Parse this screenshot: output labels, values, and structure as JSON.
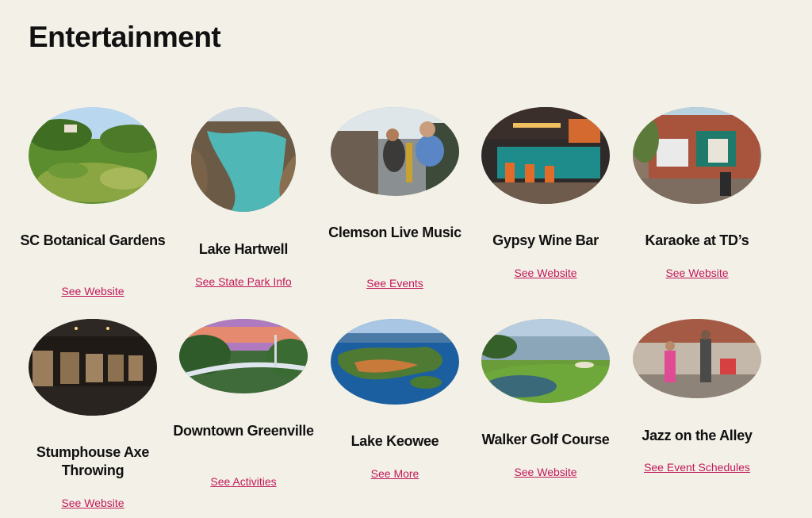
{
  "page": {
    "title": "Entertainment"
  },
  "cards": [
    {
      "title": "SC Botanical Gardens",
      "link": "See Website",
      "photo": "botanical-gardens-photo"
    },
    {
      "title": "Lake Hartwell",
      "link": "See State Park Info",
      "photo": "lake-hartwell-photo"
    },
    {
      "title": "Clemson Live Music",
      "link": "See Events",
      "photo": "live-music-photo"
    },
    {
      "title": "Gypsy Wine Bar",
      "link": "See Website",
      "photo": "wine-bar-photo"
    },
    {
      "title": "Karaoke at TD’s",
      "link": "See Website",
      "photo": "karaoke-photo"
    },
    {
      "title": "Stumphouse Axe Throwing",
      "link": "See Website",
      "photo": "axe-throwing-photo"
    },
    {
      "title": "Downtown Greenville",
      "link": "See Activities",
      "photo": "greenville-photo"
    },
    {
      "title": "Lake Keowee",
      "link": "See More",
      "photo": "lake-keowee-photo"
    },
    {
      "title": "Walker Golf Course",
      "link": "See Website",
      "photo": "golf-course-photo"
    },
    {
      "title": "Jazz on the Alley",
      "link": "See Event Schedules",
      "photo": "jazz-alley-photo"
    }
  ]
}
